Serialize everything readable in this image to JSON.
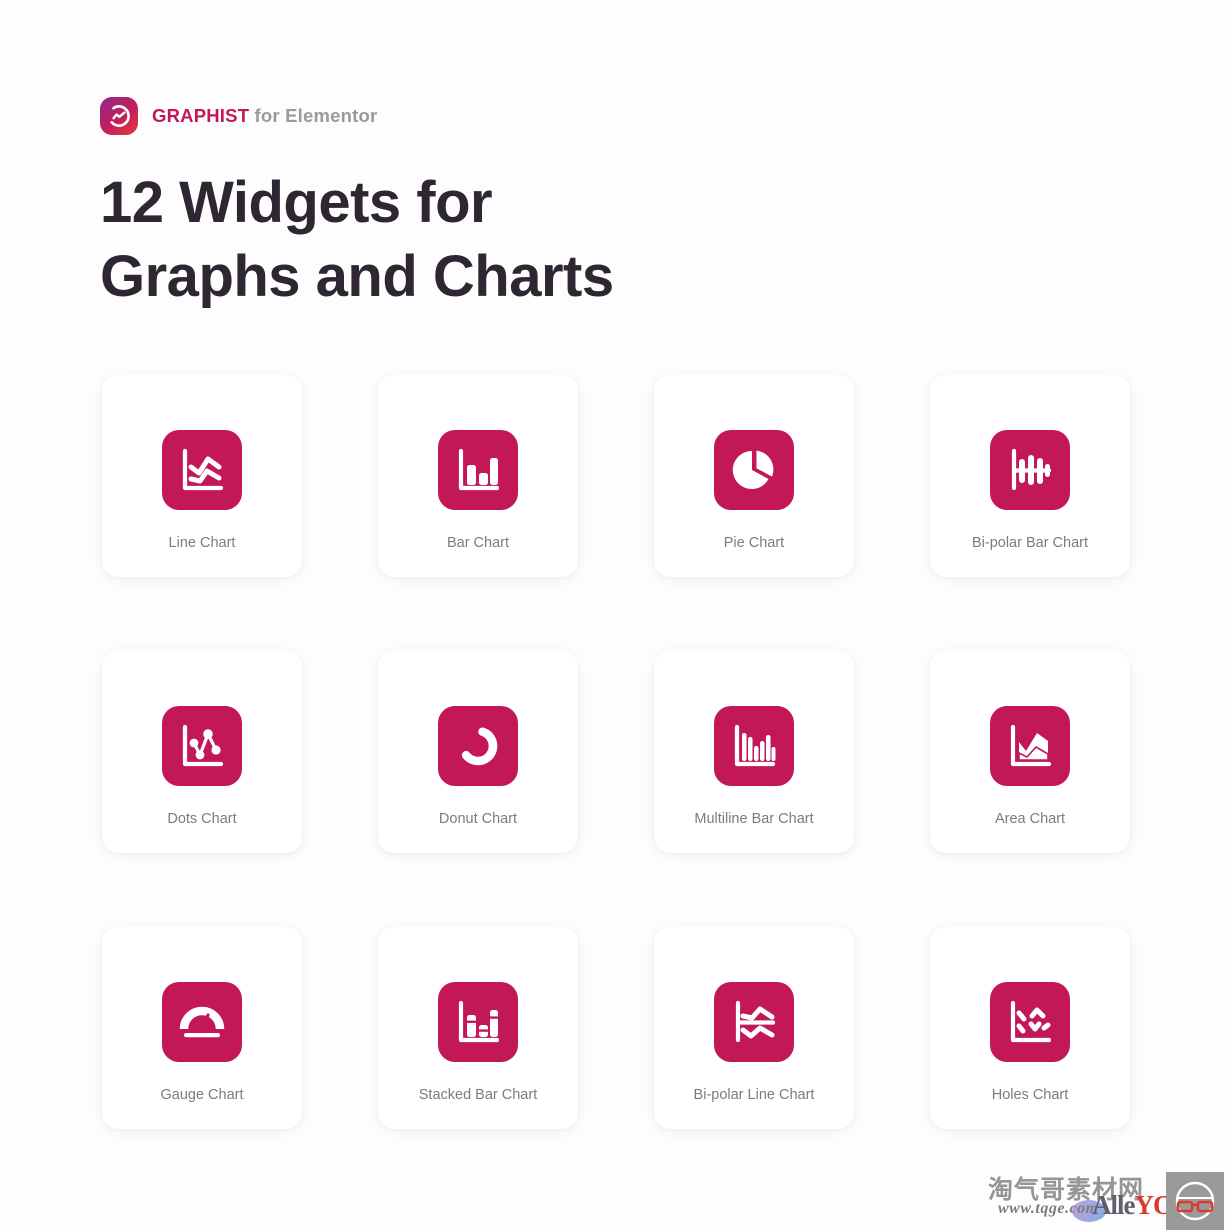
{
  "brand": {
    "logo_icon": "graphist-logo-icon",
    "name": "GRAPHIST",
    "suffix": " for Elementor"
  },
  "headline": {
    "line1": "12 Widgets for",
    "line2": "Graphs and Charts"
  },
  "colors": {
    "accent": "#c21858",
    "brand_text": "#c2185b",
    "brand_suffix": "#9a9a9a",
    "heading": "#2e2630",
    "card_label": "#7c7c80",
    "card_bg": "#ffffff",
    "page_bg": "#fdfdfd"
  },
  "cards": [
    {
      "label": "Line Chart",
      "icon": "line-chart-icon"
    },
    {
      "label": "Bar Chart",
      "icon": "bar-chart-icon"
    },
    {
      "label": "Pie Chart",
      "icon": "pie-chart-icon"
    },
    {
      "label": "Bi-polar Bar Chart",
      "icon": "bipolar-bar-chart-icon"
    },
    {
      "label": "Dots Chart",
      "icon": "dots-chart-icon"
    },
    {
      "label": "Donut Chart",
      "icon": "donut-chart-icon"
    },
    {
      "label": "Multiline Bar Chart",
      "icon": "multiline-bar-chart-icon"
    },
    {
      "label": "Area Chart",
      "icon": "area-chart-icon"
    },
    {
      "label": "Gauge Chart",
      "icon": "gauge-chart-icon"
    },
    {
      "label": "Stacked Bar Chart",
      "icon": "stacked-bar-chart-icon"
    },
    {
      "label": "Bi-polar Line Chart",
      "icon": "bipolar-line-chart-icon"
    },
    {
      "label": "Holes Chart",
      "icon": "holes-chart-icon"
    }
  ],
  "watermark": {
    "chinese": "淘气哥素材网",
    "url": "www.tqge.com",
    "logo_prefix": "Alle",
    "logo_suffix": "YOU",
    "badge_icon": "glasses-icon"
  }
}
